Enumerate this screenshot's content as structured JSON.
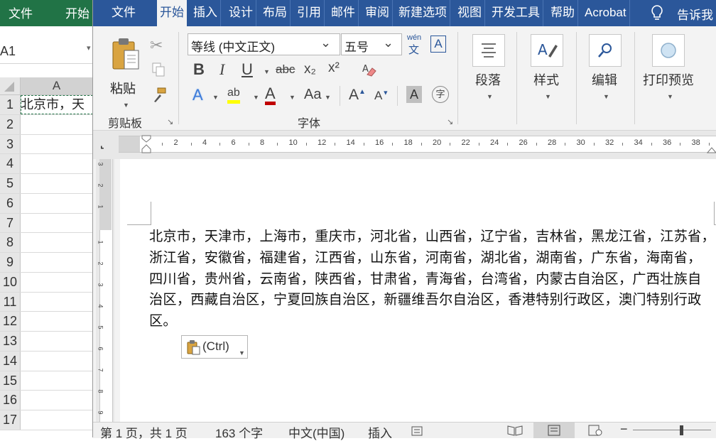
{
  "excel": {
    "tabs": [
      "文件",
      "开始"
    ],
    "name_box": "A1",
    "column_header": "A",
    "rows": [
      {
        "num": "1",
        "cell": "北京市，天"
      },
      {
        "num": "2",
        "cell": ""
      },
      {
        "num": "3",
        "cell": ""
      },
      {
        "num": "4",
        "cell": ""
      },
      {
        "num": "5",
        "cell": ""
      },
      {
        "num": "6",
        "cell": ""
      },
      {
        "num": "7",
        "cell": ""
      },
      {
        "num": "8",
        "cell": ""
      },
      {
        "num": "9",
        "cell": ""
      },
      {
        "num": "10",
        "cell": ""
      },
      {
        "num": "11",
        "cell": ""
      },
      {
        "num": "12",
        "cell": ""
      },
      {
        "num": "13",
        "cell": ""
      },
      {
        "num": "14",
        "cell": ""
      },
      {
        "num": "15",
        "cell": ""
      },
      {
        "num": "16",
        "cell": ""
      },
      {
        "num": "17",
        "cell": ""
      }
    ]
  },
  "word": {
    "tabs": [
      "文件",
      "开始",
      "插入",
      "设计",
      "布局",
      "引用",
      "邮件",
      "审阅",
      "新建选项",
      "视图",
      "开发工具",
      "帮助",
      "Acrobat"
    ],
    "tell_me": "告诉我",
    "clipboard": {
      "paste_label": "粘贴",
      "group_label": "剪贴板"
    },
    "font": {
      "font_name": "等线 (中文正文)",
      "font_size": "五号",
      "group_label": "字体",
      "bold": "B",
      "italic": "I",
      "underline": "U",
      "strike": "abc",
      "subscript": "x₂",
      "superscript": "x²",
      "text_effect": "A",
      "highlight": "ab",
      "font_color": "A",
      "change_case": "Aa",
      "grow": "A",
      "shrink": "A",
      "char_shading": "A",
      "enclose": "字",
      "phonetic_top": "wén",
      "phonetic_bottom": "文",
      "char_border": "A"
    },
    "paragraph_label": "段落",
    "styles_label": "样式",
    "editing_label": "编辑",
    "print_preview_label": "打印预览",
    "ruler_numbers": [
      "2",
      "4",
      "6",
      "8",
      "10",
      "12",
      "14",
      "16",
      "18",
      "20",
      "22",
      "24",
      "26",
      "28",
      "30",
      "32",
      "34",
      "36",
      "38"
    ],
    "vruler_numbers": [
      "3",
      "2",
      "1",
      "1",
      "2",
      "3",
      "4",
      "5",
      "6",
      "7",
      "8",
      "9"
    ],
    "document_lines": [
      "北京市，天津市，上海市，重庆市，河北省，山西省，辽宁省，吉林省，黑龙江省，江苏省，",
      "浙江省，安徽省，福建省，江西省，山东省，河南省，湖北省，湖南省，广东省，海南省，",
      "四川省，贵州省，云南省，陕西省，甘肃省，青海省，台湾省，内蒙古自治区，广西壮族自",
      "治区，西藏自治区，宁夏回族自治区，新疆维吾尔自治区，香港特别行政区，澳门特别行政",
      "区。"
    ],
    "paste_options": "(Ctrl)",
    "status": {
      "page": "第 1 页，共 1 页",
      "words": "163 个字",
      "language": "中文(中国)",
      "mode": "插入"
    },
    "colors": {
      "accent": "#2b579a",
      "excel_green": "#217346"
    }
  }
}
